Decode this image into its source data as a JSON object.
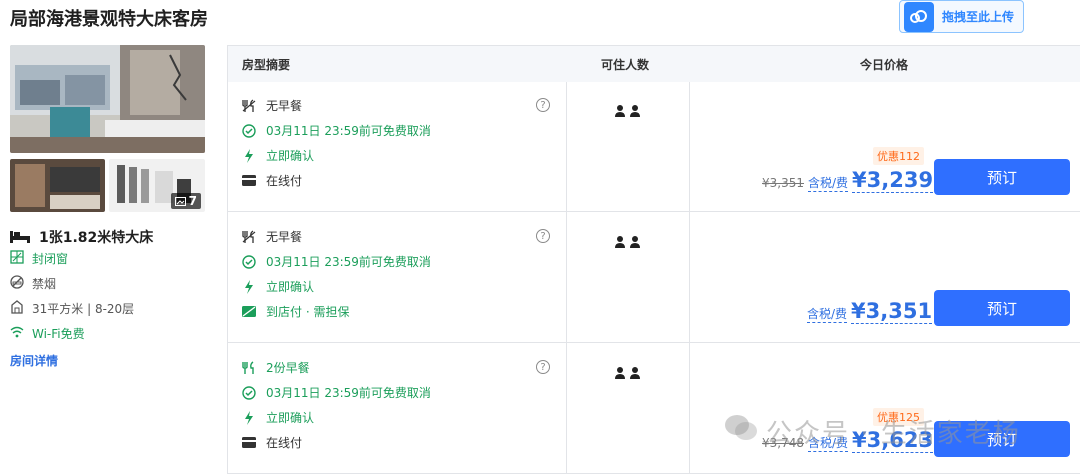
{
  "room": {
    "title": "局部海港景观特大床客房",
    "photo_count": "7",
    "bed": "1张1.82米特大床",
    "facilities": [
      "封闭窗",
      "禁烟",
      "31平方米 | 8-20层",
      "Wi-Fi免费"
    ],
    "details_link": "房间详情"
  },
  "upload": {
    "label": "拖拽至此上传"
  },
  "table": {
    "headers": [
      "房型摘要",
      "可住人数",
      "今日价格"
    ]
  },
  "offers": [
    {
      "meal": "无早餐",
      "cancel": "03月11日 23:59前可免费取消",
      "confirm": "立即确认",
      "payment": "在线付",
      "promo": "优惠112",
      "original_price": "¥3,351",
      "tax_note": "含税/费",
      "price": "¥3,239",
      "book": "预订"
    },
    {
      "meal": "无早餐",
      "cancel": "03月11日 23:59前可免费取消",
      "confirm": "立即确认",
      "payment": "到店付 · 需担保",
      "promo": "",
      "original_price": "",
      "tax_note": "含税/费",
      "price": "¥3,351",
      "book": "预订"
    },
    {
      "meal": "2份早餐",
      "cancel": "03月11日 23:59前可免费取消",
      "confirm": "立即确认",
      "payment": "在线付",
      "promo": "优惠125",
      "original_price": "¥3,748",
      "tax_note": "含税/费",
      "price": "¥3,623",
      "book": "预订"
    }
  ],
  "watermark": "公众号 · 生活家老杨",
  "colors": {
    "accent": "#2f6fff",
    "green": "#1b9e5a",
    "promo": "#ff6a1a"
  }
}
